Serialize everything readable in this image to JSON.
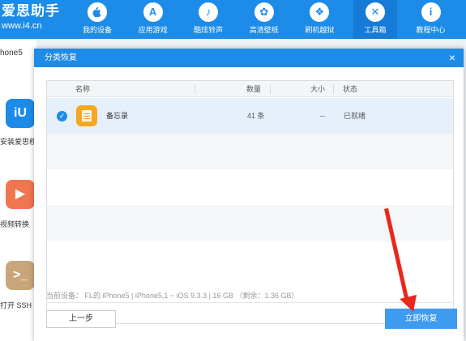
{
  "brand": {
    "name": "爱思助手",
    "url": "www.i4.cn"
  },
  "nav": [
    {
      "label": "我的设备",
      "icon": "apple-icon",
      "glyph": ""
    },
    {
      "label": "应用游戏",
      "icon": "app-store-icon",
      "glyph": "A"
    },
    {
      "label": "酷炫铃声",
      "icon": "bell-icon",
      "glyph": "♪"
    },
    {
      "label": "高清壁纸",
      "icon": "flower-icon",
      "glyph": "✿"
    },
    {
      "label": "刷机越狱",
      "icon": "dropbox-icon",
      "glyph": "❖"
    },
    {
      "label": "工具箱",
      "icon": "tools-icon",
      "glyph": "✕"
    },
    {
      "label": "教程中心",
      "icon": "info-icon",
      "glyph": "i"
    }
  ],
  "background": {
    "device_label": "hone5",
    "apps": [
      {
        "label": "安装爱思移",
        "icon": "i4-app-icon",
        "glyph": "iU",
        "color": "#1d8be8"
      },
      {
        "label": "视频转换",
        "icon": "video-convert-icon",
        "glyph": "▶",
        "color": "#f07650"
      },
      {
        "label": "打开 SSH 通",
        "icon": "ssh-terminal-icon",
        "glyph": ">_",
        "color": "#c9a57a"
      }
    ]
  },
  "dialog": {
    "title": "分类恢复",
    "close_glyph": "×",
    "columns": {
      "name": "名称",
      "count": "数量",
      "size": "大小",
      "status": "状态"
    },
    "rows": [
      {
        "name": "备忘录",
        "count": "41 条",
        "size": "--",
        "status": "已就绪",
        "selected": true,
        "icon": "notes-icon"
      }
    ],
    "device_info": "当前设备： FL的 iPhone5  |  iPhone5,1 ~ iOS 9.3.3  |  16 GB （剩余：1.36 GB）",
    "prev_button": "上一步",
    "restore_button": "立即恢复"
  },
  "colors": {
    "accent": "#1d8be8",
    "annotation_arrow": "#e8281e"
  }
}
